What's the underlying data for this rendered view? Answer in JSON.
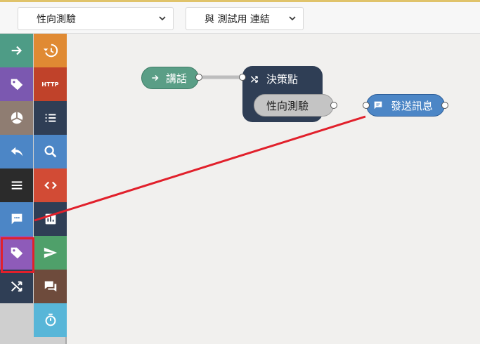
{
  "header": {
    "flow_select": {
      "value": "性向測驗",
      "icon": "chevron-down-icon"
    },
    "test_select": {
      "value": "與 測試用 連結",
      "icon": "chevron-down-icon"
    }
  },
  "palette": {
    "tiles": [
      {
        "name": "arrow-right-icon",
        "color": "#4e9c86"
      },
      {
        "name": "history-icon",
        "color": "#e08a33"
      },
      {
        "name": "tag-icon",
        "color": "#7b58b0"
      },
      {
        "name": "http-icon",
        "label": "HTTP",
        "color": "#c0422a"
      },
      {
        "name": "pie-chart-icon",
        "color": "#8f7d72"
      },
      {
        "name": "list-icon",
        "color": "#2f3e55"
      },
      {
        "name": "reply-icon",
        "color": "#4c86c6"
      },
      {
        "name": "search-icon",
        "color": "#4c86c6"
      },
      {
        "name": "menu-icon",
        "color": "#2b2b2b"
      },
      {
        "name": "code-icon",
        "color": "#d24b35"
      },
      {
        "name": "message-icon",
        "color": "#4c86c6"
      },
      {
        "name": "bar-chart-icon",
        "color": "#2f3e55"
      },
      {
        "name": "tag-icon",
        "color": "#8e5bb9"
      },
      {
        "name": "send-icon",
        "color": "#4fa06a"
      },
      {
        "name": "shuffle-icon",
        "color": "#2f3e55"
      },
      {
        "name": "forum-icon",
        "color": "#6e4b3c"
      },
      {
        "name": "timer-icon",
        "color": "#58b6d8"
      }
    ]
  },
  "canvas": {
    "nodes": {
      "speak": {
        "label": "講話",
        "icon": "arrow-right-icon"
      },
      "decision": {
        "label": "決策點",
        "icon": "shuffle-icon",
        "option": "性向測驗"
      },
      "send": {
        "label": "發送訊息",
        "icon": "message-icon"
      }
    }
  },
  "colors": {
    "annotation": "#e1202b",
    "topbar_accent": "#e0c36a"
  }
}
